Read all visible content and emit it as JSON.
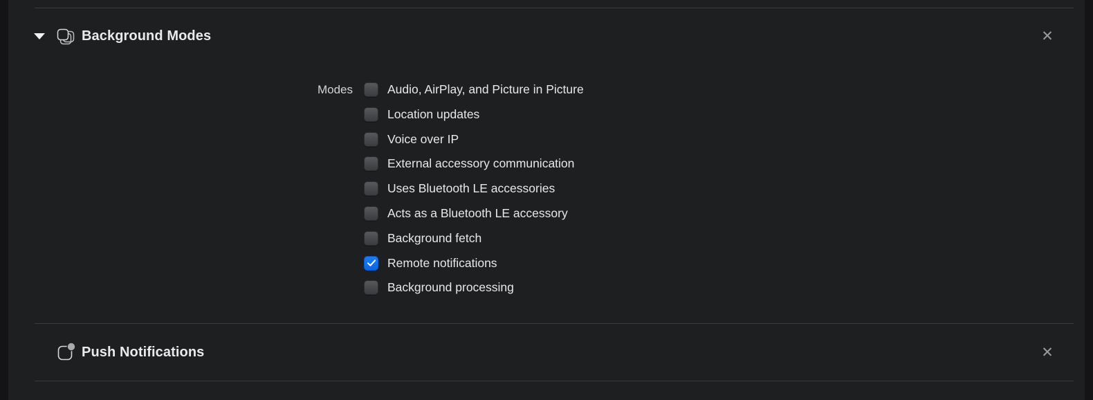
{
  "window": {
    "background_color": "#1e1f21",
    "gutter_color": "#141416",
    "accent_color": "#0a66e4",
    "divider_color": "#3a3b3d"
  },
  "capabilities": [
    {
      "id": "background-modes",
      "title": "Background Modes",
      "icon": "stacked-cards-icon",
      "expanded": true,
      "disclosure_glyph": "▼",
      "close_glyph": "✕",
      "form": {
        "field_label": "Modes",
        "options": [
          {
            "label": "Audio, AirPlay, and Picture in Picture",
            "checked": false
          },
          {
            "label": "Location updates",
            "checked": false
          },
          {
            "label": "Voice over IP",
            "checked": false
          },
          {
            "label": "External accessory communication",
            "checked": false
          },
          {
            "label": "Uses Bluetooth LE accessories",
            "checked": false
          },
          {
            "label": "Acts as a Bluetooth LE accessory",
            "checked": false
          },
          {
            "label": "Background fetch",
            "checked": false
          },
          {
            "label": "Remote notifications",
            "checked": true
          },
          {
            "label": "Background processing",
            "checked": false
          }
        ]
      }
    },
    {
      "id": "push-notifications",
      "title": "Push Notifications",
      "icon": "badge-notification-icon",
      "expanded": false,
      "close_glyph": "✕"
    }
  ]
}
